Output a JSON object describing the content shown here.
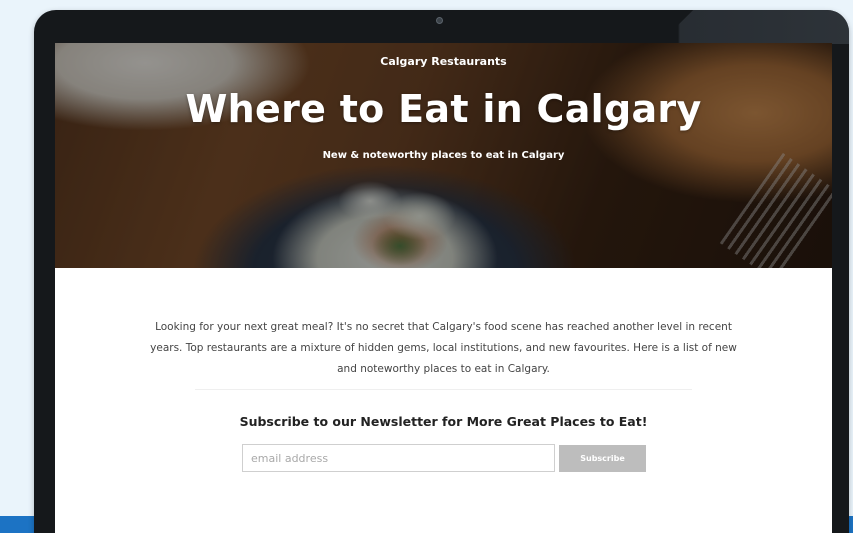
{
  "hero": {
    "kicker": "Calgary Restaurants",
    "title": "Where to Eat in Calgary",
    "subtitle": "New & noteworthy places to eat in Calgary"
  },
  "intro": {
    "text": "Looking for your next great meal? It's no secret that Calgary's food scene has reached another level in recent years. Top restaurants are a mixture of hidden gems, local institutions, and new favourites. Here is a list of new and noteworthy places to eat in Calgary."
  },
  "newsletter": {
    "heading": "Subscribe to our Newsletter for More Great Places to Eat!",
    "email_placeholder": "email address",
    "email_value": "",
    "button_label": "Subscribe"
  },
  "colors": {
    "page_background": "#eaf4fb",
    "bottom_band": "#1c73c4",
    "bezel": "#15181b",
    "button_background": "#bdbdbd"
  },
  "icons": {
    "camera": "webcam-dot-icon"
  }
}
